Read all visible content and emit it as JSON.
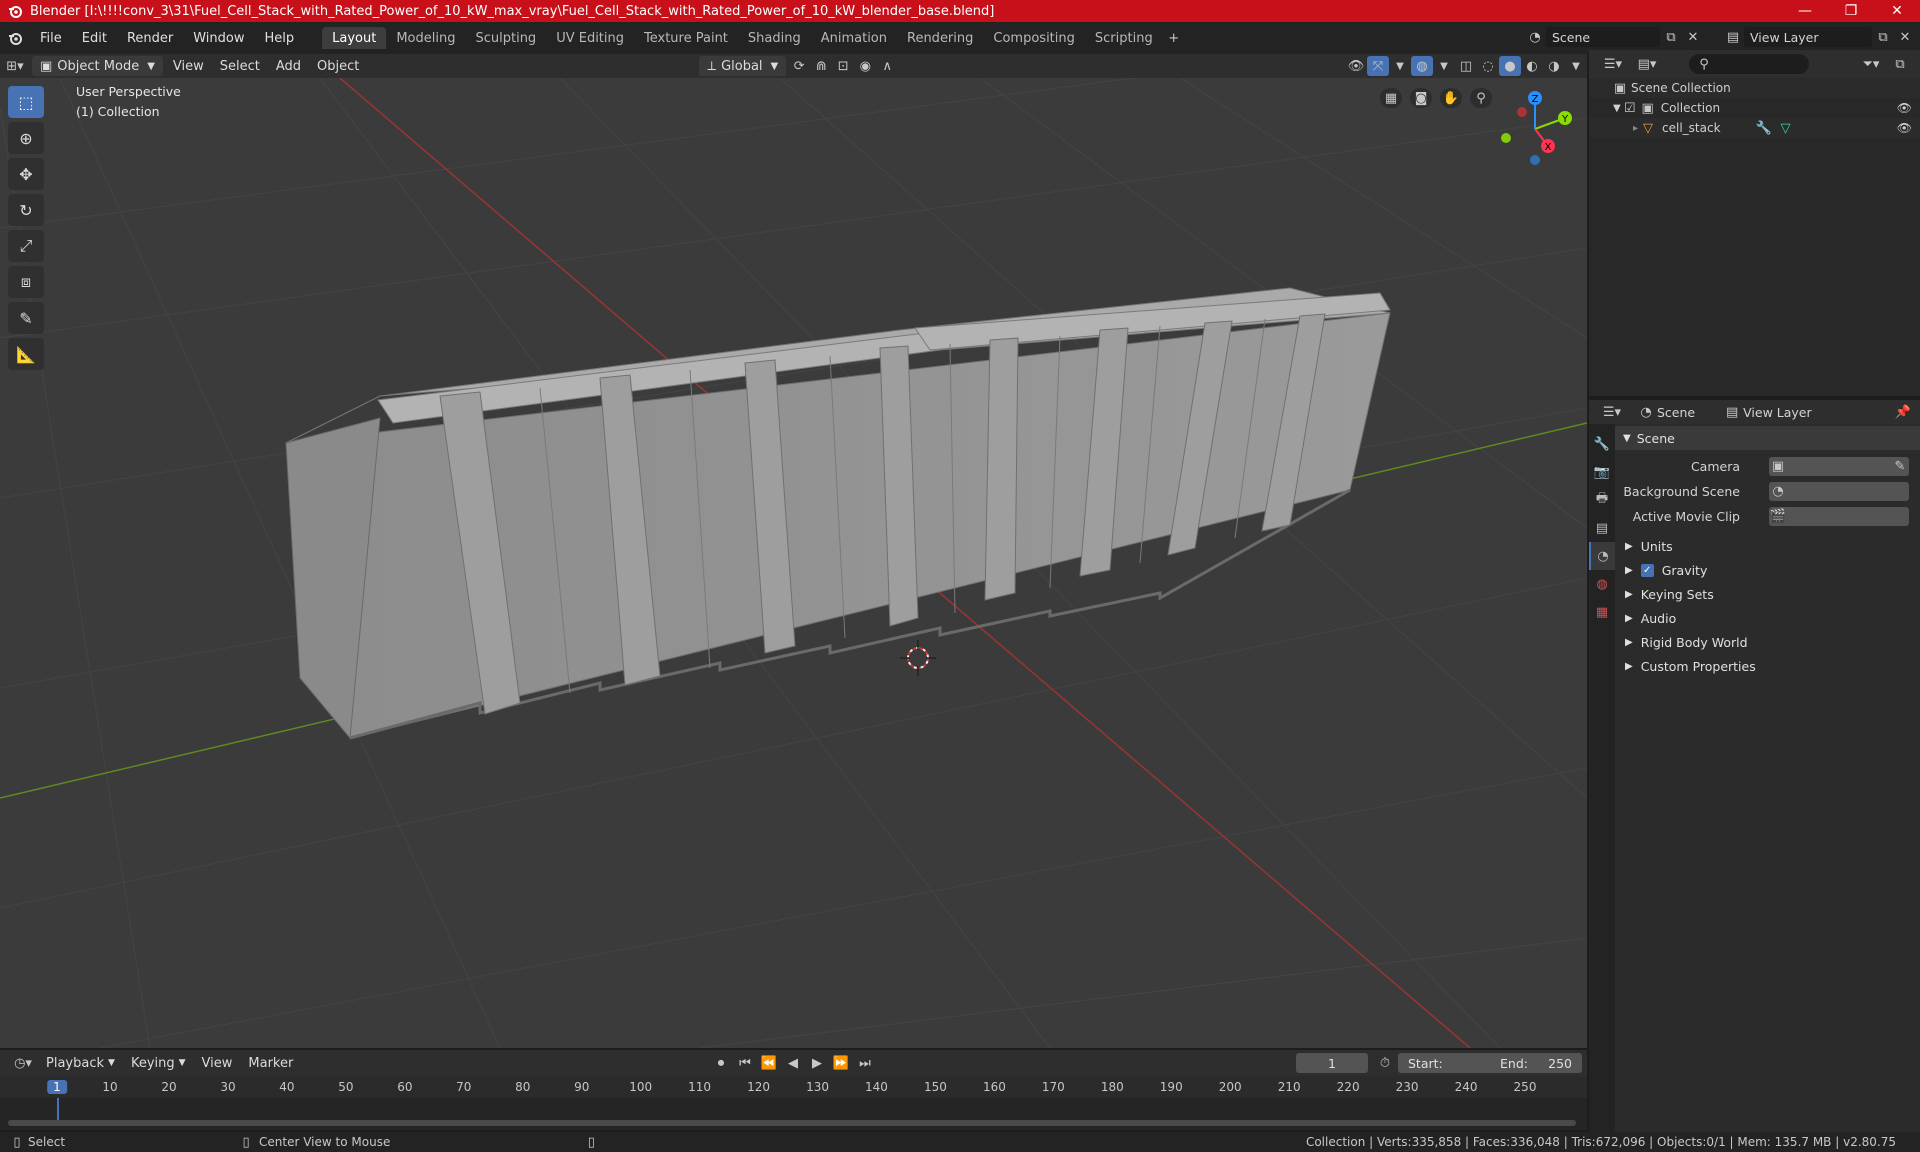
{
  "window": {
    "title": "Blender [I:\\!!!!conv_3\\31\\Fuel_Cell_Stack_with_Rated_Power_of_10_kW_max_vray\\Fuel_Cell_Stack_with_Rated_Power_of_10_kW_blender_base.blend]",
    "minimize": "—",
    "maximize": "❐",
    "close": "✕"
  },
  "menus": [
    "File",
    "Edit",
    "Render",
    "Window",
    "Help"
  ],
  "workspaces": [
    "Layout",
    "Modeling",
    "Sculpting",
    "UV Editing",
    "Texture Paint",
    "Shading",
    "Animation",
    "Rendering",
    "Compositing",
    "Scripting"
  ],
  "active_workspace": "Layout",
  "scene_selector": {
    "value": "Scene"
  },
  "view_layer_selector": {
    "value": "View Layer"
  },
  "viewport_header": {
    "mode": "Object Mode",
    "menus": [
      "View",
      "Select",
      "Add",
      "Object"
    ],
    "orientation": "Global"
  },
  "viewport": {
    "perspective_label": "User Perspective",
    "collection_label": "(1) Collection",
    "gizmo": {
      "z": "Z",
      "y": "Y",
      "x": "X"
    }
  },
  "outliner": {
    "root": "Scene Collection",
    "collection": "Collection",
    "object": "cell_stack"
  },
  "properties": {
    "tab_scene": "Scene",
    "tab_view_layer": "View Layer",
    "section_title": "Scene",
    "fields": [
      {
        "label": "Camera"
      },
      {
        "label": "Background Scene"
      },
      {
        "label": "Active Movie Clip"
      }
    ],
    "panels": [
      "Units",
      "Gravity",
      "Keying Sets",
      "Audio",
      "Rigid Body World",
      "Custom Properties"
    ],
    "gravity_checked": true
  },
  "timeline": {
    "menus": [
      "Playback",
      "Keying",
      "View",
      "Marker"
    ],
    "current_frame": "1",
    "start_label": "Start:",
    "start_value": "1",
    "end_label": "End:",
    "end_value": "250",
    "ticks": [
      "1",
      "10",
      "20",
      "30",
      "40",
      "50",
      "60",
      "70",
      "80",
      "90",
      "100",
      "110",
      "120",
      "130",
      "140",
      "150",
      "160",
      "170",
      "180",
      "190",
      "200",
      "210",
      "220",
      "230",
      "240",
      "250"
    ]
  },
  "statusbar": {
    "select": "Select",
    "center": "Center View to Mouse",
    "stats": "Collection | Verts:335,858 | Faces:336,048 | Tris:672,096 | Objects:0/1 | Mem: 135.7 MB | v2.80.75"
  },
  "colors": {
    "titlebar": "#c8101a",
    "accent": "#4772b3",
    "x_axis": "#ff3352",
    "y_axis": "#8bdc00",
    "z_axis": "#2890ff"
  }
}
